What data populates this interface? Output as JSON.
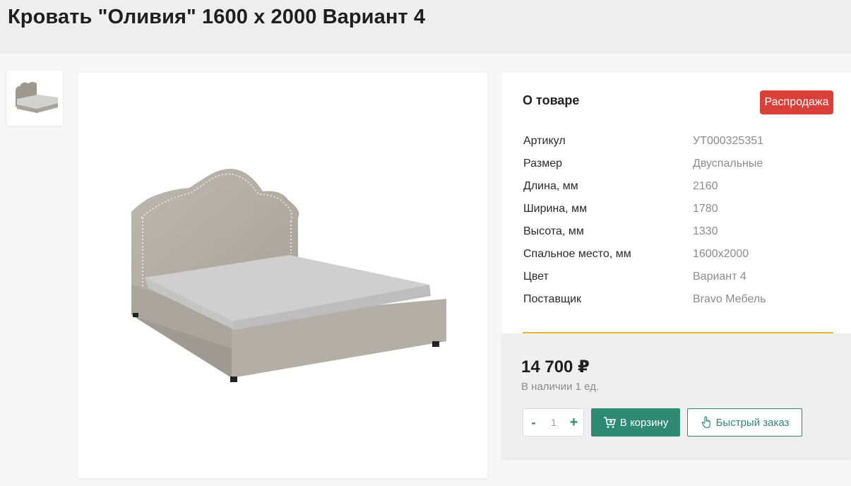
{
  "product": {
    "title": "Кровать \"Оливия\" 1600 х 2000 Вариант 4"
  },
  "gallery": {
    "thumbnail_icon": "bed-thumbnail-icon",
    "main_image_icon": "bed-image-icon"
  },
  "info": {
    "heading": "О товаре",
    "badge": "Распродажа",
    "specs": [
      {
        "label": "Артикул",
        "value": "УТ000325351"
      },
      {
        "label": "Размер",
        "value": "Двуспальные"
      },
      {
        "label": "Длина, мм",
        "value": "2160"
      },
      {
        "label": "Ширина, мм",
        "value": "1780"
      },
      {
        "label": "Высота, мм",
        "value": "1330"
      },
      {
        "label": "Спальное место, мм",
        "value": "1600х2000"
      },
      {
        "label": "Цвет",
        "value": "Вариант 4"
      },
      {
        "label": "Поставщик",
        "value": "Bravo Мебель"
      }
    ]
  },
  "purchase": {
    "price": "14 700 ₽",
    "stock": "В наличии 1 ед.",
    "qty_minus": "-",
    "qty_value": "1",
    "qty_plus": "+",
    "cart_label": "В корзину",
    "cart_icon": "cart-plus-icon",
    "quick_label": "Быстрый заказ",
    "quick_icon": "hand-pointer-icon"
  },
  "colors": {
    "accent_green": "#2f8a72",
    "sale_red": "#d9403a",
    "divider_gold": "#e8b92a"
  }
}
